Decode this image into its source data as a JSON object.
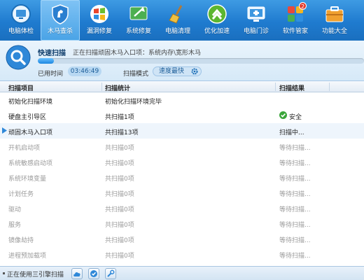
{
  "toolbar": {
    "items": [
      {
        "label": "电脑体检",
        "icon": "monitor-check-icon"
      },
      {
        "label": "木马查杀",
        "icon": "shield-horse-icon",
        "active": true
      },
      {
        "label": "漏洞修复",
        "icon": "windows-logo-icon"
      },
      {
        "label": "系统修复",
        "icon": "repair-tools-icon"
      },
      {
        "label": "电脑清理",
        "icon": "broom-icon"
      },
      {
        "label": "优化加速",
        "icon": "speedup-arrows-icon"
      },
      {
        "label": "电脑门诊",
        "icon": "clinic-monitor-icon"
      },
      {
        "label": "软件管家",
        "icon": "software-grid-icon",
        "badge": "2"
      },
      {
        "label": "功能大全",
        "icon": "toolbox-icon"
      }
    ]
  },
  "scan": {
    "title": "快速扫描",
    "status": "正在扫描顽固木马入口项：系统内存\\宽形木马",
    "progress": 0.05,
    "elapsed_label": "已用时间",
    "elapsed_value": "03:46:49",
    "mode_label": "扫描模式",
    "mode_value": "速度最快"
  },
  "table": {
    "columns": [
      "扫描项目",
      "扫描统计",
      "扫描结果"
    ],
    "rows": [
      {
        "item": "初始化扫描环境",
        "stat": "初始化扫描环境完毕",
        "result": "",
        "state": "done"
      },
      {
        "item": "硬盘主引导区",
        "stat": "共扫描1项",
        "result": "安全",
        "state": "safe"
      },
      {
        "item": "顽固木马入口项",
        "stat": "共扫描13项",
        "result": "扫描中...",
        "state": "current"
      },
      {
        "item": "开机启动项",
        "stat": "共扫描0项",
        "result": "等待扫描...",
        "state": "pending"
      },
      {
        "item": "系统敏感启动项",
        "stat": "共扫描0项",
        "result": "等待扫描...",
        "state": "pending"
      },
      {
        "item": "系统环境变量",
        "stat": "共扫描0项",
        "result": "等待扫描...",
        "state": "pending"
      },
      {
        "item": "计划任务",
        "stat": "共扫描0项",
        "result": "等待扫描...",
        "state": "pending"
      },
      {
        "item": "驱动",
        "stat": "共扫描0项",
        "result": "等待扫描...",
        "state": "pending"
      },
      {
        "item": "服务",
        "stat": "共扫描0项",
        "result": "等待扫描...",
        "state": "pending"
      },
      {
        "item": "镜像劫持",
        "stat": "共扫描0项",
        "result": "等待扫描...",
        "state": "pending"
      },
      {
        "item": "进程预加载项",
        "stat": "共扫描0项",
        "result": "等待扫描...",
        "state": "pending"
      }
    ]
  },
  "footer": {
    "text": "正在使用三引擎扫描",
    "buttons": [
      {
        "icon": "cloud-engine-icon"
      },
      {
        "icon": "qvm-engine-icon"
      },
      {
        "icon": "repair-engine-icon"
      }
    ]
  },
  "colors": {
    "toolbar_blue": "#1f7bcf",
    "safe_green": "#2f8a2f",
    "scanning_orange": "#e07b00",
    "pending_gray": "#9a9a9a"
  }
}
